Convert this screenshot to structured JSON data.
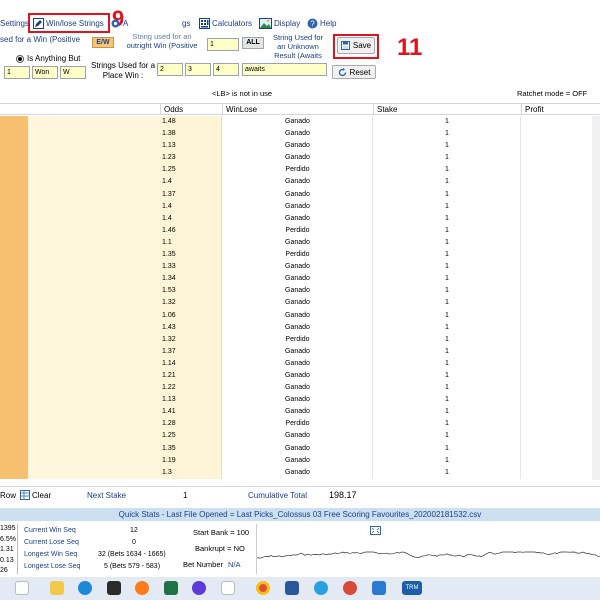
{
  "toolbar": {
    "settings": "Settings",
    "winlose": "Win/lose Strings",
    "callout_9": "9",
    "a_label": "A",
    "gs_label": "gs",
    "calculators": "Calculators",
    "display": "Display",
    "help": "Help"
  },
  "strings": {
    "used_win_label": "sed for a Win (Positive",
    "ew_label": "E/W",
    "outright_label_1": "String used for an",
    "outright_label_2": "outright Win (Positive",
    "outright_value": "1",
    "all_label": "ALL",
    "unknown_label_1": "String Used for",
    "unknown_label_2": "an Unknown",
    "unknown_label_3": "Result  (Awaits",
    "save_label": "Save",
    "callout_11": "11",
    "is_anything_but": "Is Anything But",
    "win_values": [
      "1",
      "Won",
      "W"
    ],
    "place_label_1": "Strings Used for a",
    "place_label_2": "Place Win :",
    "place_values": [
      "2",
      "3",
      "4"
    ],
    "awaits_value": "awaits",
    "reset_label": "Reset"
  },
  "notice": {
    "lb": "<LB> is not in use",
    "ratchet": "Ratchet mode = OFF"
  },
  "table": {
    "headers": [
      "Odds",
      "WinLose",
      "Stake",
      "Profit"
    ],
    "rows": [
      [
        "1.48",
        "Ganado",
        "1"
      ],
      [
        "1.38",
        "Ganado",
        "1"
      ],
      [
        "1.13",
        "Ganado",
        "1"
      ],
      [
        "1.23",
        "Ganado",
        "1"
      ],
      [
        "1.25",
        "Perdido",
        "1"
      ],
      [
        "1.4",
        "Ganado",
        "1"
      ],
      [
        "1.37",
        "Ganado",
        "1"
      ],
      [
        "1.4",
        "Ganado",
        "1"
      ],
      [
        "1.4",
        "Ganado",
        "1"
      ],
      [
        "1.46",
        "Perdido",
        "1"
      ],
      [
        "1.1",
        "Ganado",
        "1"
      ],
      [
        "1.35",
        "Perdido",
        "1"
      ],
      [
        "1.33",
        "Ganado",
        "1"
      ],
      [
        "1.34",
        "Ganado",
        "1"
      ],
      [
        "1.53",
        "Ganado",
        "1"
      ],
      [
        "1.32",
        "Ganado",
        "1"
      ],
      [
        "1.06",
        "Ganado",
        "1"
      ],
      [
        "1.43",
        "Ganado",
        "1"
      ],
      [
        "1.32",
        "Perdido",
        "1"
      ],
      [
        "1.37",
        "Ganado",
        "1"
      ],
      [
        "1.14",
        "Ganado",
        "1"
      ],
      [
        "1.21",
        "Ganado",
        "1"
      ],
      [
        "1.22",
        "Ganado",
        "1"
      ],
      [
        "1.13",
        "Ganado",
        "1"
      ],
      [
        "1.41",
        "Ganado",
        "1"
      ],
      [
        "1.28",
        "Perdido",
        "1"
      ],
      [
        "1.25",
        "Ganado",
        "1"
      ],
      [
        "1.35",
        "Ganado",
        "1"
      ],
      [
        "1.19",
        "Ganado",
        "1"
      ],
      [
        "1.3",
        "Ganado",
        "1"
      ]
    ]
  },
  "footer": {
    "row_label": "Row",
    "clear_label": "Clear",
    "next_stake_label": "Next Stake",
    "next_stake_value": "1",
    "cumulative_label": "Cumulative Total",
    "cumulative_value": "198.17"
  },
  "quickstats": {
    "title": "Quick Stats - Last File Opened = Last Picks_Colossus 03 Free Scoring Favourites_202002181532.csv",
    "left_values": [
      "1395",
      "6.5%",
      "1.31",
      "0.13",
      "26"
    ],
    "current_win_seq_label": "Current Win Seq",
    "current_win_seq_value": "12",
    "current_lose_seq_label": "Current Lose Seq",
    "current_lose_seq_value": "0",
    "longest_win_seq_label": "Longest Win Seq",
    "longest_win_seq_value": "32  (Bets 1634 - 1665)",
    "longest_lose_seq_label": "Longest Lose Seq",
    "longest_lose_seq_value": "5  (Bets 579 - 583)",
    "start_bank_label": "Start Bank = 100",
    "bankrupt_label": "Bankrupt = NO",
    "bet_number_label": "Bet Number",
    "bet_number_value": "N/A"
  },
  "taskbar": {
    "icons": [
      "file-explorer-icon",
      "edge-icon",
      "firefox-icon",
      "excel-icon",
      "firefox-dev-icon",
      "chrome-icon",
      "word-icon",
      "telegram-icon",
      "ccleaner-icon",
      "vscode-icon",
      "trm-icon"
    ],
    "trm_label": "TRM"
  },
  "colors": {
    "accent": "#1a3f8a",
    "callout": "#e0141e",
    "input_bg": "#ffffc8",
    "row_tan": "#fdf5d6",
    "row_orange": "#f7c070",
    "quickstats_bg": "#cde0f2"
  }
}
